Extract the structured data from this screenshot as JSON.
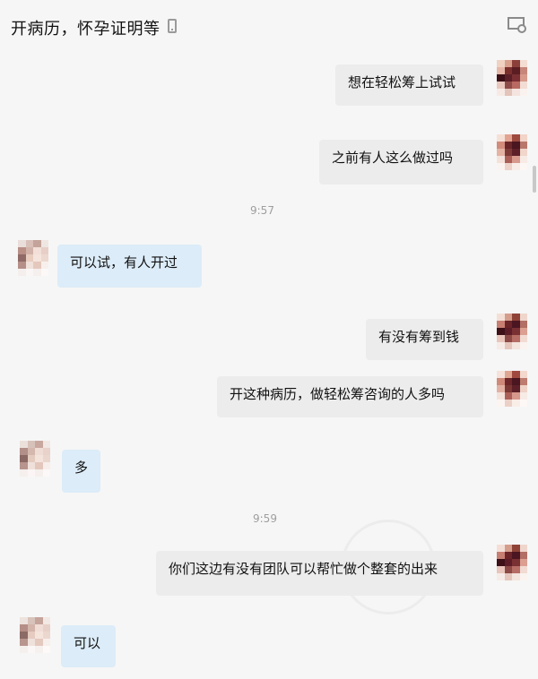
{
  "header": {
    "title": "开病历，怀孕证明等"
  },
  "messages": [
    {
      "text": "想在轻松筹上试试"
    },
    {
      "text": "之前有人这么做过吗"
    },
    {
      "text": "可以试，有人开过"
    },
    {
      "text": "有没有筹到钱"
    },
    {
      "text": "开这种病历，做轻松筹咨询的人多吗"
    },
    {
      "text": "多"
    },
    {
      "text": "你们这边有没有团队可以帮忙做个整套的出来"
    },
    {
      "text": "可以"
    }
  ],
  "timestamps": [
    "9:57",
    "9:59"
  ],
  "colors": {
    "incoming_bubble": "#dcecf8",
    "outgoing_bubble": "#ececec",
    "background": "#f6f6f6"
  },
  "icons": {
    "top_right": "chat-settings-icon",
    "title_suffix": "phone-icon"
  }
}
